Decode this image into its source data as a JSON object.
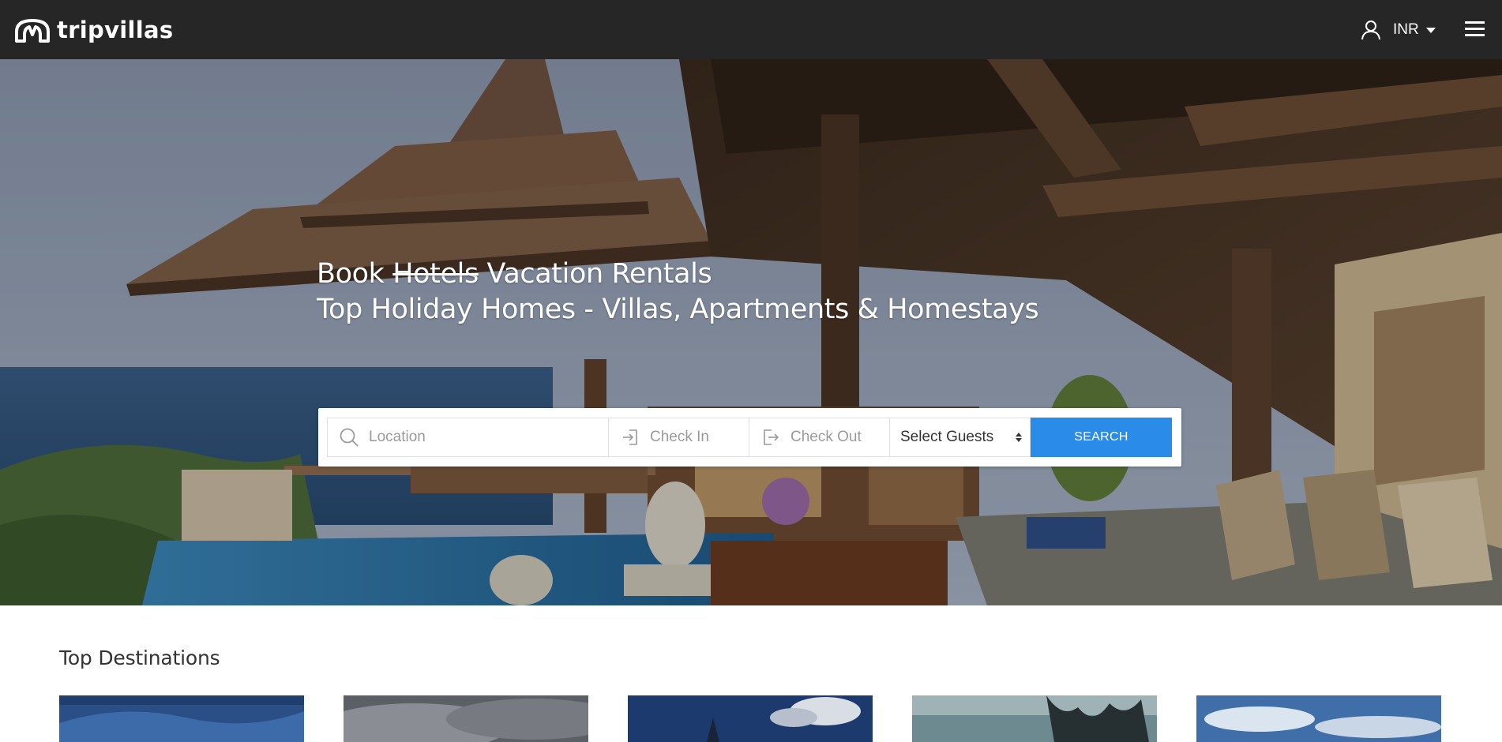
{
  "brand": {
    "name": "tripvillas"
  },
  "header": {
    "currency": "INR",
    "icons": {
      "user": "user-icon",
      "currency_toggle": "caret-down-icon",
      "menu": "hamburger-menu-icon"
    }
  },
  "hero": {
    "headline_prefix": "Book",
    "headline_struck": "Hotels",
    "headline_suffix": "Vacation Rentals",
    "subheadline": "Top Holiday Homes - Villas, Apartments & Homestays"
  },
  "search": {
    "location_placeholder": "Location",
    "checkin_placeholder": "Check In",
    "checkout_placeholder": "Check Out",
    "guests_value": "Select Guests",
    "button_label": "SEARCH",
    "colors": {
      "button": "#2b8be8"
    }
  },
  "destinations": {
    "title": "Top Destinations",
    "cards": [
      "card-1",
      "card-2",
      "card-3",
      "card-4",
      "card-5"
    ]
  }
}
